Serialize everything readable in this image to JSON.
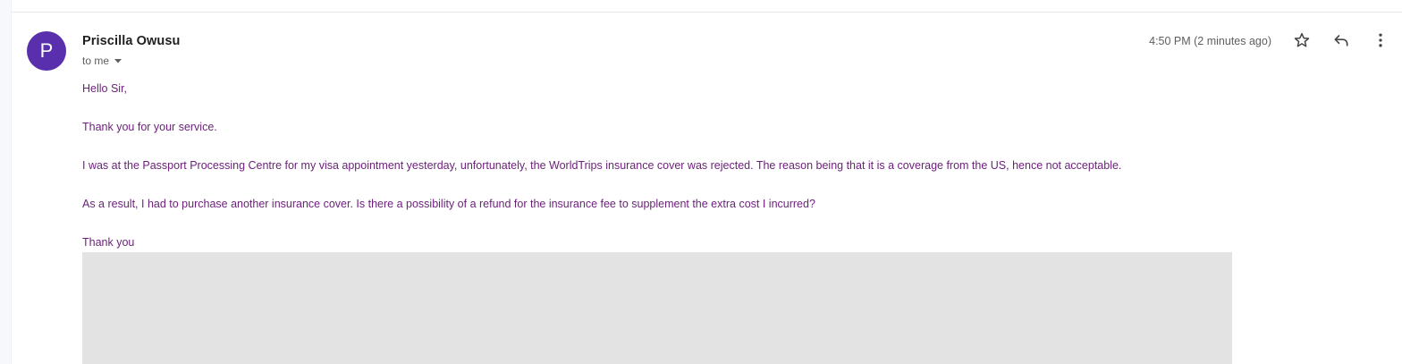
{
  "message": {
    "avatar_letter": "P",
    "avatar_color": "#5a2fad",
    "sender_name": "Priscilla Owusu",
    "recipient_label": "to me",
    "timestamp": "4:50 PM (2 minutes ago)",
    "body_color": "#6b1f7a",
    "body_lines": [
      "Hello Sir,",
      "Thank you for your service.",
      "I was at the Passport Processing Centre for my visa appointment yesterday, unfortunately, the WorldTrips insurance cover was rejected. The reason being that it is a coverage from the US, hence not acceptable.",
      "As a result, I had to purchase another insurance cover. Is there a possibility of a refund for the insurance fee to supplement the extra cost I incurred?",
      "Thank you"
    ]
  },
  "icons": {
    "star": "star-icon",
    "reply": "reply-icon",
    "more": "more-vert-icon",
    "recipient_dropdown": "caret-down-icon"
  }
}
